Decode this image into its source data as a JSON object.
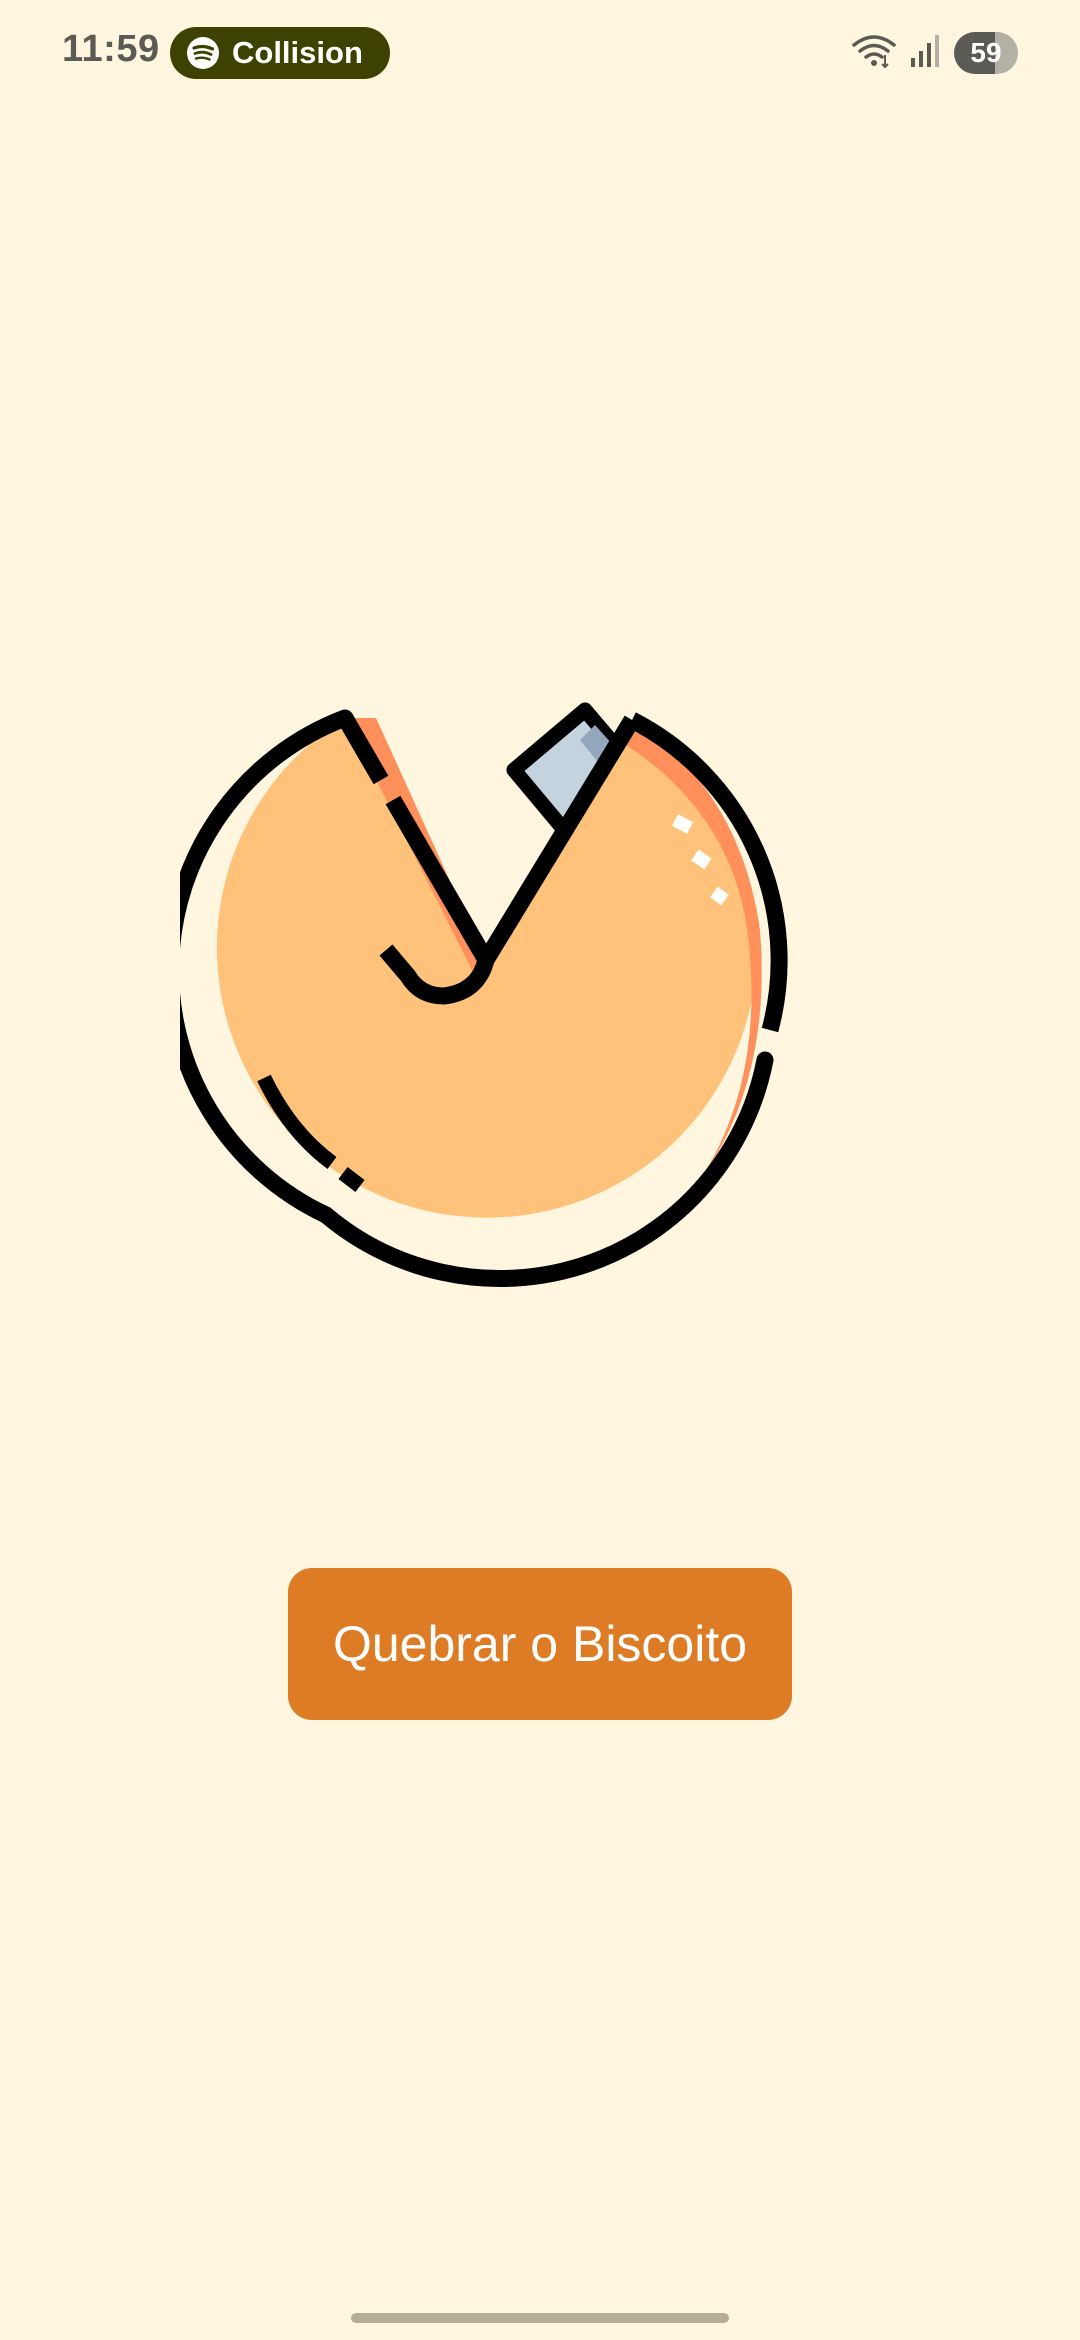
{
  "status_bar": {
    "time": "11:59",
    "media": {
      "app_icon": "spotify-icon",
      "title": "Collision"
    },
    "icons": [
      "wifi-icon",
      "signal-icon"
    ],
    "battery": "59"
  },
  "illustration": {
    "icon": "fortune-cookie-icon"
  },
  "main": {
    "button_label": "Quebrar o Biscoito"
  },
  "colors": {
    "background": "#FEF6DE",
    "button": "#DD7C24",
    "cookie_fill": "#FFC27A",
    "cookie_shadow": "#FF8F5B",
    "paper": "#C5D3DF",
    "media_pill": "#3E4200"
  }
}
